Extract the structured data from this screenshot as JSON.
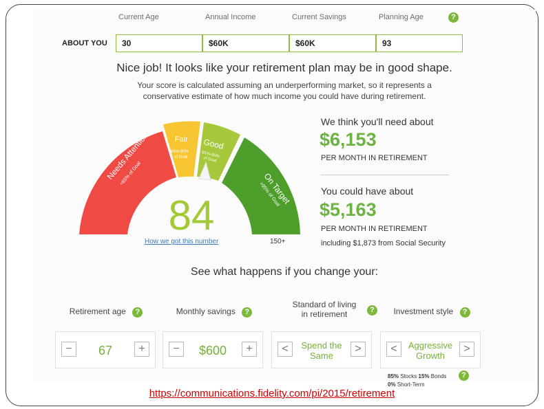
{
  "about": {
    "section_label": "ABOUT YOU",
    "fields": [
      {
        "label": "Current Age",
        "value": "30"
      },
      {
        "label": "Annual Income",
        "value": "$60K"
      },
      {
        "label": "Current Savings",
        "value": "$60K"
      },
      {
        "label": "Planning Age",
        "value": "93"
      }
    ]
  },
  "headline": "Nice job! It looks like your retirement plan may be in good shape.",
  "subtext_line1": "Your score is calculated assuming an underperforming market, so it represents a",
  "subtext_line2": "conservative estimate of how much income you could have during retirement.",
  "gauge": {
    "score": "84",
    "max_label": "150+",
    "link": "How we got this number",
    "segments": [
      {
        "name": "Needs Attention",
        "range": "<65% of Goal",
        "color": "#f04a45"
      },
      {
        "name": "Fair",
        "range": "65%-80% of Goal",
        "color": "#f7c531"
      },
      {
        "name": "Good",
        "range": "81%-95% of Goal",
        "color": "#a6c83a"
      },
      {
        "name": "On Target",
        "range": ">95% of Goal",
        "color": "#4d9e2b"
      }
    ]
  },
  "need": {
    "intro": "We think you'll need about",
    "amount": "$6,153",
    "per": "PER MONTH IN RETIREMENT"
  },
  "have": {
    "intro": "You could have about",
    "amount": "$5,163",
    "per": "PER MONTH IN RETIREMENT",
    "note": "including $1,873 from Social Security"
  },
  "change_heading": "See what happens if you change your:",
  "controls": {
    "retirement_age": {
      "label": "Retirement age",
      "value": "67",
      "minus": "−",
      "plus": "+"
    },
    "monthly_savings": {
      "label": "Monthly savings",
      "value": "$600",
      "minus": "−",
      "plus": "+"
    },
    "standard": {
      "label_line1": "Standard of living",
      "label_line2": "in retirement",
      "value_line1": "Spend the",
      "value_line2": "Same",
      "prev": "<",
      "next": ">"
    },
    "investment": {
      "label": "Investment style",
      "value_line1": "Aggressive",
      "value_line2": "Growth",
      "prev": "<",
      "next": ">"
    }
  },
  "allocation": {
    "stocks_pct": "85%",
    "stocks": "Stocks",
    "bonds_pct": "15%",
    "bonds": "Bonds",
    "short_pct": "0%",
    "short": "Short-Term"
  },
  "help_glyph": "?",
  "source_url": "https://communications.fidelity.com/pi/2015/retirement",
  "colors": {
    "accent_green": "#6cb33f",
    "link_red": "#d40000",
    "link_blue": "#3a7bbf"
  }
}
